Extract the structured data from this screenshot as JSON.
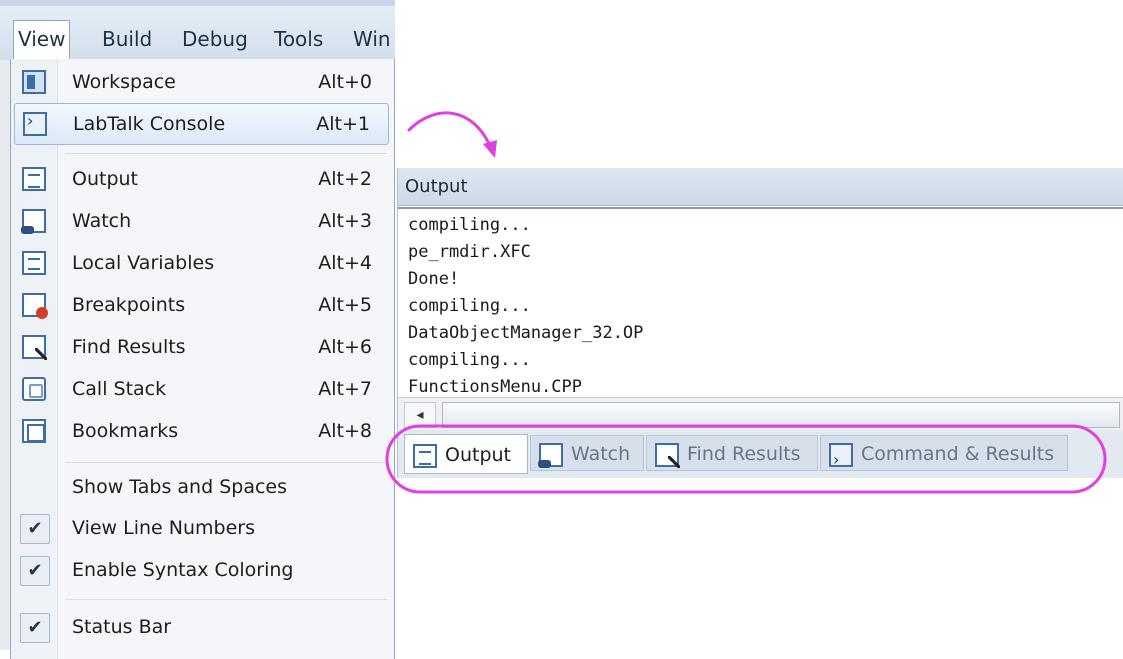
{
  "menubar": {
    "items": [
      {
        "label": "View"
      },
      {
        "label": "Build"
      },
      {
        "label": "Debug"
      },
      {
        "label": "Tools"
      },
      {
        "label": "Win"
      }
    ]
  },
  "view_menu": {
    "items": [
      {
        "icon": "workspace-icon",
        "label": "Workspace",
        "shortcut": "Alt+0"
      },
      {
        "icon": "console-icon",
        "label": "LabTalk Console",
        "shortcut": "Alt+1",
        "highlighted": true
      },
      {
        "icon": "output-icon",
        "label": "Output",
        "shortcut": "Alt+2"
      },
      {
        "icon": "watch-icon",
        "label": "Watch",
        "shortcut": "Alt+3"
      },
      {
        "icon": "local-variables-icon",
        "label": "Local Variables",
        "shortcut": "Alt+4"
      },
      {
        "icon": "breakpoints-icon",
        "label": "Breakpoints",
        "shortcut": "Alt+5"
      },
      {
        "icon": "find-results-icon",
        "label": "Find Results",
        "shortcut": "Alt+6"
      },
      {
        "icon": "call-stack-icon",
        "label": "Call Stack",
        "shortcut": "Alt+7"
      },
      {
        "icon": "bookmarks-icon",
        "label": "Bookmarks",
        "shortcut": "Alt+8"
      },
      {
        "label": "Show Tabs and Spaces",
        "checked": false
      },
      {
        "label": "View Line Numbers",
        "checked": true
      },
      {
        "label": "Enable Syntax Coloring",
        "checked": true
      },
      {
        "label": "Status Bar",
        "checked": true
      }
    ],
    "check_glyph": "✔"
  },
  "output_panel": {
    "title": "Output",
    "lines": [
      "compiling...",
      "pe_rmdir.XFC",
      "Done!",
      "compiling...",
      "DataObjectManager_32.OP",
      "compiling...",
      "FunctionsMenu.CPP"
    ],
    "scroll_left_glyph": "◂",
    "tabs": [
      {
        "label": "Output",
        "icon": "output-tab-icon",
        "active": true
      },
      {
        "label": "Watch",
        "icon": "watch-tab-icon",
        "active": false
      },
      {
        "label": "Find Results",
        "icon": "find-results-tab-icon",
        "active": false
      },
      {
        "label": "Command & Results",
        "icon": "command-results-tab-icon",
        "active": false
      }
    ]
  },
  "colors": {
    "annotation": "#e040e0",
    "menu_highlight": "#dde9f7",
    "icon_blue": "#3c6da8"
  }
}
